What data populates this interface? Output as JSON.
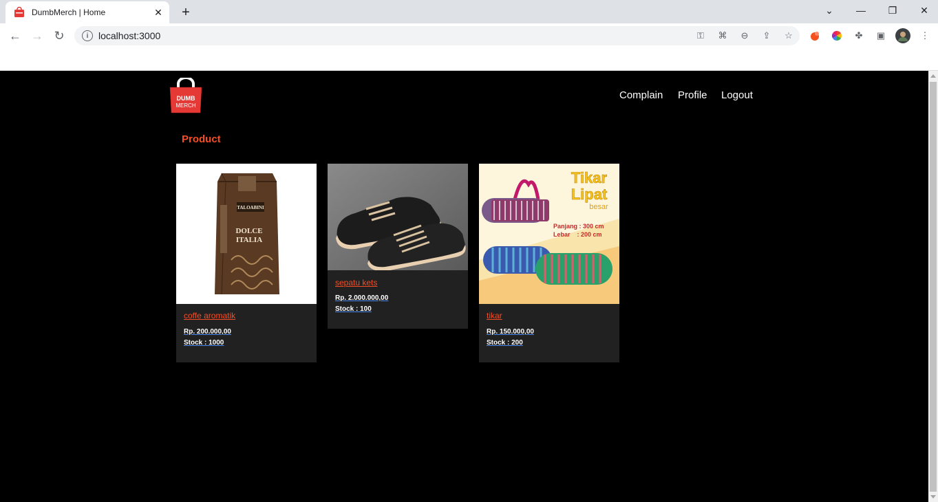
{
  "browser": {
    "tab_title": "DumbMerch | Home",
    "url": "localhost:3000"
  },
  "header": {
    "logo_line1": "DUMB",
    "logo_line2": "MERCH",
    "nav": [
      "Complain",
      "Profile",
      "Logout"
    ]
  },
  "section_title": "Product",
  "products": [
    {
      "name": "coffe aromatik",
      "price": "Rp. 200.000,00",
      "stock": "Stock : 1000"
    },
    {
      "name": "sepatu kets",
      "price": "Rp. 2.000.000,00",
      "stock": "Stock : 100"
    },
    {
      "name": "tikar",
      "price": "Rp. 150.000,00",
      "stock": "Stock : 200"
    }
  ],
  "images": {
    "coffee_brand": "TALOABINI",
    "coffee_line1": "DOLCE",
    "coffee_line2": "ITALIA",
    "tikar_title1": "Tikar",
    "tikar_title2": "Lipat",
    "tikar_title3": "besar",
    "tikar_dim1": "Panjang : 300 cm",
    "tikar_dim2": "Lebar    : 200 cm"
  },
  "colors": {
    "accent": "#f74d24",
    "card_bg": "#212121",
    "page_bg": "#000000"
  }
}
